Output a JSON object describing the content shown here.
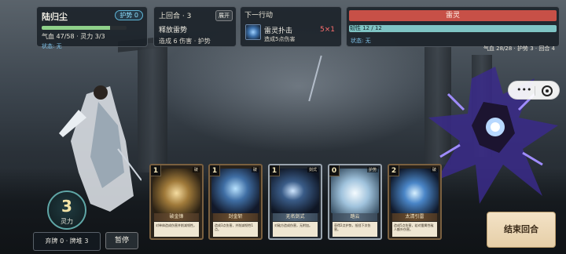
{
  "player": {
    "name": "陆归尘",
    "shield_label": "护势 0",
    "hp_fraction": 0.81,
    "stats": "气血 47/58 · 灵力 3/3",
    "status": "状态: 无"
  },
  "last_turn": {
    "title": "上回合 · 3",
    "expand_label": "展开",
    "action": "释放雷势",
    "effect": "造成 6 伤害 · 护势"
  },
  "next_action": {
    "title": "下一行动",
    "icon": "thunder-claw-icon",
    "name": "雷灵扑击",
    "desc": "造成5点伤害",
    "count": "5×1"
  },
  "boss": {
    "name": "雷灵",
    "hp_fraction": 1.0,
    "toughness_text": "韧性 12 / 12",
    "toughness_fraction": 1.0,
    "status": "状态: 无",
    "stats": "气血 28/28 · 护势 3 · 回合 4"
  },
  "energy": {
    "value": "3",
    "label": "灵力"
  },
  "pile_text": "弃牌 0 · 牌堆 3",
  "pause_label": "暂停",
  "end_turn_label": "结束回合",
  "cards": [
    {
      "cost": "1",
      "type": "破",
      "name": "破金锋",
      "desc": "对单体造成伤害并削减韧性。"
    },
    {
      "cost": "1",
      "type": "破",
      "name": "封金斩",
      "desc": "造成3点伤害，并削减韧性1点。"
    },
    {
      "cost": "1",
      "type": "剑式",
      "name": "无名剑式",
      "desc": "对敌方造成伤害，无附加。"
    },
    {
      "cost": "0",
      "type": "护势",
      "name": "踏云",
      "desc": "获得2点护势，抵挡下次伤害。"
    },
    {
      "cost": "2",
      "type": "破",
      "name": "太清引雷",
      "desc": "造成5点伤害，若对雷属性敌人额外伤害。"
    }
  ],
  "capsule": {
    "more_label": "•••"
  },
  "colors": {
    "player_hp": "#8fd18a",
    "boss_hp": "#c75047",
    "toughness": "#7fc4c4",
    "end_turn_bg": "#f3e2c6"
  }
}
